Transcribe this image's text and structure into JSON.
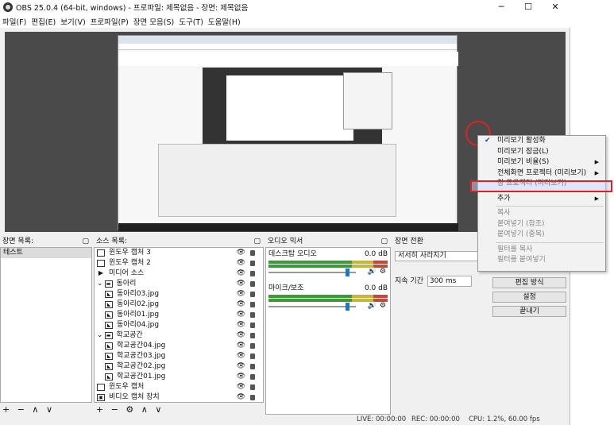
{
  "window": {
    "title": "OBS 25.0.4 (64-bit, windows) - 프로파일: 제목없음 - 장면: 제목없음",
    "minimize": "─",
    "maximize": "☐",
    "close": "✕"
  },
  "menu": [
    "파일(F)",
    "편집(E)",
    "보기(V)",
    "프로파일(P)",
    "장면 모음(S)",
    "도구(T)",
    "도움말(H)"
  ],
  "scenes": {
    "title": "장면 목록:",
    "items": [
      "테스트"
    ],
    "footer": "+ − ∧ ∨"
  },
  "sources": {
    "title": "소스 목록:",
    "footer": "+ − ⚙ ∧ ∨",
    "items": [
      {
        "label": "윈도우 캡처 3",
        "icon": "window-icon"
      },
      {
        "label": "윈도우 캡처 2",
        "icon": "window-icon"
      },
      {
        "label": "미디어 소스",
        "icon": "play-icon"
      },
      {
        "label": "동아리",
        "icon": "folder-icon"
      },
      {
        "label": "동아리03.jpg",
        "icon": "image-icon"
      },
      {
        "label": "동아리02.jpg",
        "icon": "image-icon"
      },
      {
        "label": "동아리01.jpg",
        "icon": "image-icon"
      },
      {
        "label": "동아리04.jpg",
        "icon": "image-icon"
      },
      {
        "label": "학교공간",
        "icon": "folder-icon"
      },
      {
        "label": "학교공간04.jpg",
        "icon": "image-icon"
      },
      {
        "label": "학교공간03.jpg",
        "icon": "image-icon"
      },
      {
        "label": "학교공간02.jpg",
        "icon": "image-icon"
      },
      {
        "label": "학교공간01.jpg",
        "icon": "image-icon"
      },
      {
        "label": "윈도우 캡처",
        "icon": "window-icon"
      },
      {
        "label": "비디오 캡처 장치",
        "icon": "camera-icon"
      }
    ]
  },
  "mixer": {
    "title": "오디오 믹서",
    "tracks": [
      {
        "name": "데스크탑 오디오",
        "db": "0.0 dB"
      },
      {
        "name": "마이크/보조",
        "db": "0.0 dB"
      }
    ]
  },
  "transitions": {
    "title": "장면 전환",
    "selected": "서서히 사라지기",
    "duration_label": "지속 기간",
    "duration": "300 ms"
  },
  "controls": {
    "buttons": [
      "편집 방식",
      "설정",
      "끝내기"
    ]
  },
  "status": {
    "live": "LIVE: 00:00:00",
    "rec": "REC: 00:00:00",
    "cpu": "CPU: 1.2%, 60.00 fps"
  },
  "context_menu": {
    "items": [
      {
        "label": "미리보기 활성화",
        "checked": true
      },
      {
        "label": "미리보기 잠금(L)"
      },
      {
        "label": "미리보기 비율(S)",
        "submenu": true
      },
      {
        "label": "전체화면 프로젝터 (미리보기)",
        "submenu": true
      },
      {
        "label": "창 프로젝터 (미리보기)",
        "highlighted": true
      },
      {
        "sep": true
      },
      {
        "label": "추가",
        "submenu": true
      },
      {
        "sep": true
      },
      {
        "label": "복사",
        "disabled": true
      },
      {
        "label": "붙여넣기 (참조)",
        "disabled": true
      },
      {
        "label": "붙여넣기 (중복)",
        "disabled": true
      },
      {
        "sep": true
      },
      {
        "label": "필터를 복사",
        "disabled": true
      },
      {
        "label": "필터를 붙여넣기",
        "disabled": true
      }
    ]
  }
}
